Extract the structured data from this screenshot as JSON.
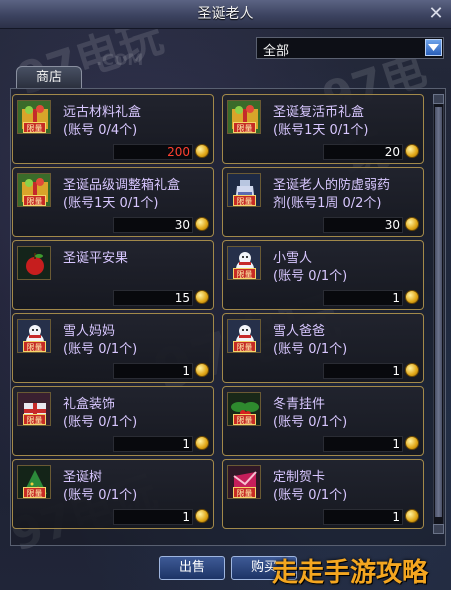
{
  "window": {
    "title": "圣诞老人",
    "close_glyph": "✕"
  },
  "filter": {
    "selected": "全部"
  },
  "tabs": [
    {
      "label": "商店"
    }
  ],
  "items": [
    {
      "name": "远古材料礼盒",
      "limit": "(账号 0/4个)",
      "price": "200",
      "price_color": "#ff4030",
      "icon": "gift-box-icon",
      "badge": "限量"
    },
    {
      "name": "圣诞复活币礼盒",
      "limit": "(账号1天 0/1个)",
      "price": "20",
      "price_color": "#ffffff",
      "icon": "gift-box-icon",
      "badge": "限量"
    },
    {
      "name": "圣诞品级调整箱礼盒",
      "limit": "(账号1天 0/1个)",
      "price": "30",
      "price_color": "#ffffff",
      "icon": "gift-box-icon",
      "badge": "限量"
    },
    {
      "name": "圣诞老人的防虚弱药",
      "limit": "剂(账号1周 0/2个)",
      "price": "30",
      "price_color": "#ffffff",
      "icon": "potion-icon",
      "badge": "限量"
    },
    {
      "name": "圣诞平安果",
      "limit": "",
      "price": "15",
      "price_color": "#ffffff",
      "icon": "apple-icon",
      "badge": ""
    },
    {
      "name": "小雪人",
      "limit": "(账号 0/1个)",
      "price": "1",
      "price_color": "#ffffff",
      "icon": "snowman-icon",
      "badge": "限量"
    },
    {
      "name": "雪人妈妈",
      "limit": "(账号 0/1个)",
      "price": "1",
      "price_color": "#ffffff",
      "icon": "snowman-icon",
      "badge": "限量"
    },
    {
      "name": "雪人爸爸",
      "limit": "(账号 0/1个)",
      "price": "1",
      "price_color": "#ffffff",
      "icon": "snowman-icon",
      "badge": "限量"
    },
    {
      "name": "礼盒装饰",
      "limit": "(账号 0/1个)",
      "price": "1",
      "price_color": "#ffffff",
      "icon": "gift-decoration-icon",
      "badge": "限量"
    },
    {
      "name": "冬青挂件",
      "limit": "(账号 0/1个)",
      "price": "1",
      "price_color": "#ffffff",
      "icon": "holly-icon",
      "badge": "限量"
    },
    {
      "name": "圣诞树",
      "limit": "(账号 0/1个)",
      "price": "1",
      "price_color": "#ffffff",
      "icon": "christmas-tree-icon",
      "badge": "限量"
    },
    {
      "name": "定制贺卡",
      "limit": "(账号 0/1个)",
      "price": "1",
      "price_color": "#ffffff",
      "icon": "greeting-card-icon",
      "badge": "限量"
    }
  ],
  "buttons": {
    "sell": "出售",
    "buy": "购买"
  },
  "watermarks": {
    "site": "97电玩",
    "site_sub": ".COM",
    "brand": "走走手游攻略"
  },
  "colors": {
    "card_border": "#a2894a",
    "item_text": "#d8c7ff",
    "coin": "#e0a616"
  }
}
